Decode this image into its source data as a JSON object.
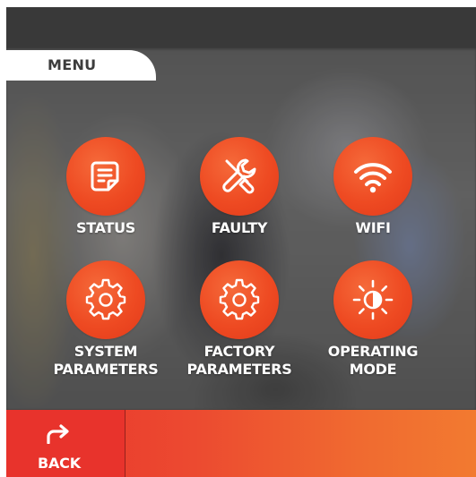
{
  "header": {
    "menu_tab_label": "MENU"
  },
  "menu": {
    "items": [
      {
        "id": "status",
        "label_lines": [
          "STATUS"
        ],
        "icon": "document-icon"
      },
      {
        "id": "faulty",
        "label_lines": [
          "FAULTY"
        ],
        "icon": "tools-icon"
      },
      {
        "id": "wifi",
        "label_lines": [
          "WIFI"
        ],
        "icon": "wifi-icon"
      },
      {
        "id": "system-parameters",
        "label_lines": [
          "SYSTEM",
          "PARAMETERS"
        ],
        "icon": "gear-icon"
      },
      {
        "id": "factory-parameters",
        "label_lines": [
          "FACTORY",
          "PARAMETERS"
        ],
        "icon": "gear-icon"
      },
      {
        "id": "operating-mode",
        "label_lines": [
          "OPERATING",
          "MODE"
        ],
        "icon": "brightness-icon"
      }
    ]
  },
  "footer": {
    "back_label": "BACK",
    "back_icon": "share-arrow-icon"
  },
  "colors": {
    "accent": "#ee4a22",
    "bottom_bar_start": "#e8332c",
    "bottom_bar_end": "#f27a30",
    "top_bar": "#393939",
    "label_text": "#ffffff",
    "menu_tab_text": "#3c3c3c"
  }
}
